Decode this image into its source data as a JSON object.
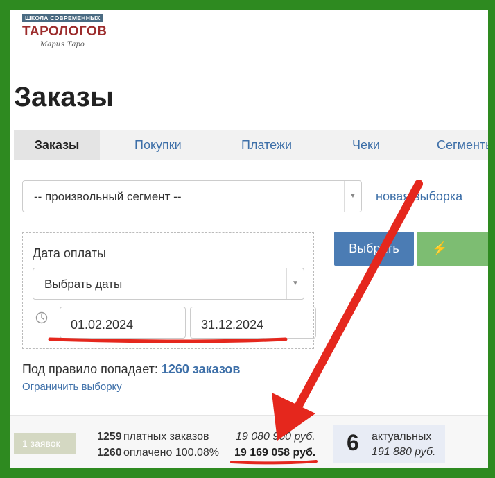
{
  "logo": {
    "top_line": "ШКОЛА СОВРЕМЕННЫХ",
    "main": "ТАРОЛОГОВ",
    "signature": "Мария Таро"
  },
  "page": {
    "title": "Заказы"
  },
  "tabs": [
    {
      "label": "Заказы",
      "active": true
    },
    {
      "label": "Покупки",
      "active": false
    },
    {
      "label": "Платежи",
      "active": false
    },
    {
      "label": "Чеки",
      "active": false
    },
    {
      "label": "Сегменты",
      "active": false
    }
  ],
  "segment": {
    "selected": "-- произвольный сегмент --",
    "new_selection_link": "новая выборка"
  },
  "filter": {
    "label": "Дата оплаты",
    "select_value": "Выбрать даты",
    "date_from": "01.02.2024",
    "date_to": "31.12.2024"
  },
  "buttons": {
    "select": "Выбрать",
    "action": "Действия"
  },
  "rule": {
    "prefix": "Под правило попадает:",
    "count": "1260 заказов",
    "limit_link": "Ограничить выборку"
  },
  "stats": {
    "requests_badge": "1 заявок",
    "paid_count": "1259",
    "paid_label": "платных заказов",
    "paid_amount": "19 080 900 руб.",
    "total_count": "1260",
    "total_label": "оплачено 100.08%",
    "total_amount": "19 169 058 руб.",
    "actual_count": "6",
    "actual_label": "актуальных",
    "actual_amount": "191 880 руб."
  },
  "colors": {
    "frame": "#2e8a20",
    "link": "#3d6fa8",
    "primary_button": "#4b7cb4",
    "success_button": "#7dbd72",
    "annotation": "#e5271d"
  },
  "icons": {
    "clock": "clock-icon",
    "bolt": "bolt-icon",
    "dropdown": "chevron-down-icon"
  }
}
